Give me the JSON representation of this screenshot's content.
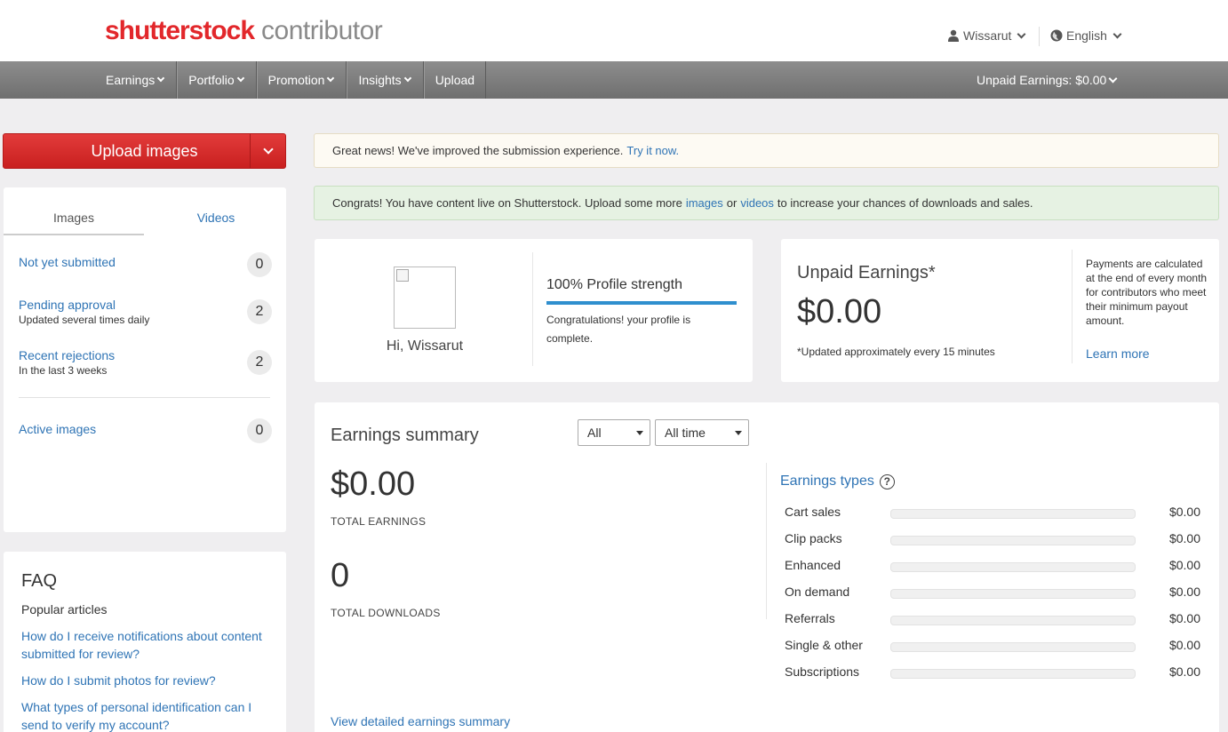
{
  "header": {
    "brand": "shutterstock",
    "brand_sub": "contributor",
    "user_name": "Wissarut",
    "language": "English"
  },
  "nav": {
    "items": [
      {
        "label": "Earnings",
        "dropdown": true
      },
      {
        "label": "Portfolio",
        "dropdown": true
      },
      {
        "label": "Promotion",
        "dropdown": true
      },
      {
        "label": "Insights",
        "dropdown": true
      },
      {
        "label": "Upload",
        "dropdown": false
      }
    ],
    "unpaid_label": "Unpaid Earnings: $0.00"
  },
  "upload_button": {
    "label": "Upload images"
  },
  "content_tabs": {
    "images": "Images",
    "videos": "Videos",
    "active": "Images"
  },
  "stats": [
    {
      "title": "Not yet submitted",
      "subtitle": "",
      "count": "0"
    },
    {
      "title": "Pending approval",
      "subtitle": "Updated several times daily",
      "count": "2"
    },
    {
      "title": "Recent rejections",
      "subtitle": "In the last 3 weeks",
      "count": "2"
    },
    {
      "title": "Active images",
      "subtitle": "",
      "count": "0"
    }
  ],
  "faq": {
    "title": "FAQ",
    "popular": "Popular articles",
    "links": [
      "How do I receive notifications about content submitted for review?",
      "How do I submit photos for review?",
      "What types of personal identification can I send to verify my account?"
    ]
  },
  "alerts": {
    "info_text": "Great news! We've improved the submission experience.",
    "info_link": "Try it now.",
    "success_pre": "Congrats! You have content live on Shutterstock. Upload some more",
    "success_link1": "images",
    "success_mid": "or",
    "success_link2": "videos",
    "success_post": "to increase your chances of downloads and sales."
  },
  "profile": {
    "greeting": "Hi, Wissarut",
    "strength_label": "100% Profile strength",
    "strength_percent": 100,
    "message": "Congratulations! your profile is complete."
  },
  "unpaid": {
    "title": "Unpaid Earnings*",
    "amount": "$0.00",
    "note": "*Updated approximately every 15 minutes",
    "info": "Payments are calculated at the end of every month for contributors who meet their minimum payout amount.",
    "learn_more": "Learn more"
  },
  "earnings_summary": {
    "title": "Earnings summary",
    "filter_type": "All",
    "filter_time": "All time",
    "total_earnings": "$0.00",
    "total_earnings_label": "TOTAL EARNINGS",
    "total_downloads": "0",
    "total_downloads_label": "TOTAL DOWNLOADS",
    "view_detail": "View detailed earnings summary",
    "types_title": "Earnings types",
    "types": [
      {
        "name": "Cart sales",
        "amount": "$0.00",
        "fraction": 0
      },
      {
        "name": "Clip packs",
        "amount": "$0.00",
        "fraction": 0
      },
      {
        "name": "Enhanced",
        "amount": "$0.00",
        "fraction": 0
      },
      {
        "name": "On demand",
        "amount": "$0.00",
        "fraction": 0
      },
      {
        "name": "Referrals",
        "amount": "$0.00",
        "fraction": 0
      },
      {
        "name": "Single & other",
        "amount": "$0.00",
        "fraction": 0
      },
      {
        "name": "Subscriptions",
        "amount": "$0.00",
        "fraction": 0
      }
    ]
  },
  "icons": {
    "user": "user-icon",
    "globe": "globe-icon",
    "help": "question-circle-icon",
    "chevron": "chevron-down-icon"
  },
  "colors": {
    "brand_red": "#e2272b",
    "link_blue": "#2f74b5",
    "nav_gray": "#7d7d7d",
    "progress_blue": "#2f8fce"
  }
}
